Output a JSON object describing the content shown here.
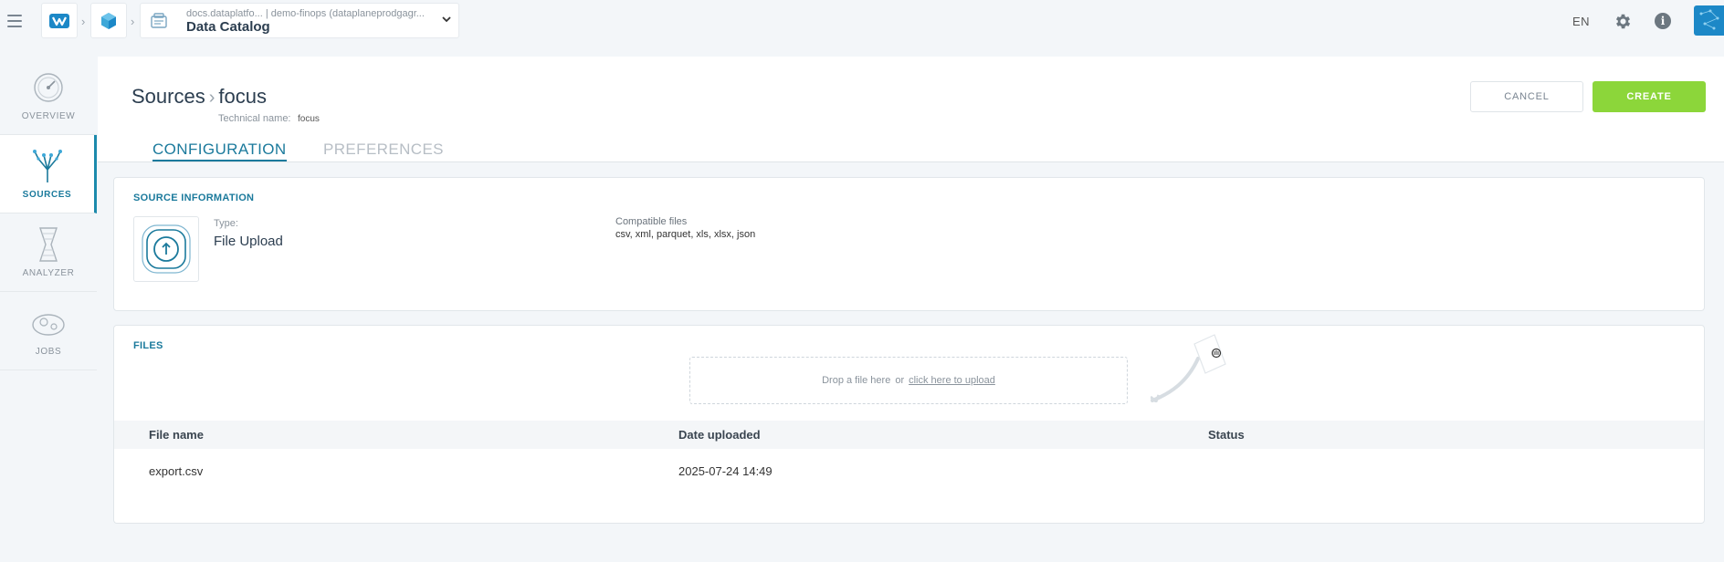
{
  "topbar": {
    "context_app": "docs.dataplatfo... | demo-finops (dataplaneprodgagr...",
    "context_title": "Data Catalog",
    "language": "EN"
  },
  "sidebar": {
    "items": [
      {
        "label": "OVERVIEW",
        "icon": "gauge-icon",
        "active": false
      },
      {
        "label": "SOURCES",
        "icon": "sources-tree-icon",
        "active": true
      },
      {
        "label": "ANALYZER",
        "icon": "analyzer-icon",
        "active": false
      },
      {
        "label": "JOBS",
        "icon": "jobs-icon",
        "active": false
      }
    ]
  },
  "header": {
    "breadcrumb_parent": "Sources",
    "breadcrumb_current": "focus",
    "technical_name_label": "Technical name:",
    "technical_name_value": "focus",
    "tabs": [
      {
        "label": "CONFIGURATION",
        "active": true
      },
      {
        "label": "PREFERENCES",
        "active": false
      }
    ],
    "cancel_label": "CANCEL",
    "create_label": "CREATE"
  },
  "source_info": {
    "title": "SOURCE INFORMATION",
    "type_label": "Type:",
    "type_value": "File Upload",
    "compatible_label": "Compatible files",
    "compatible_value": "csv, xml, parquet, xls, xlsx, json"
  },
  "files": {
    "title": "FILES",
    "drop_text": "Drop a file here",
    "or_text": "or",
    "upload_link": "click here to upload",
    "columns": [
      "File name",
      "Date uploaded",
      "Status"
    ],
    "rows": [
      {
        "file_name": "export.csv",
        "date_uploaded": "2025-07-24 14:49",
        "status": ""
      }
    ]
  },
  "colors": {
    "accent": "#1b7a9c",
    "create_green": "#8cd63a",
    "brand_blue": "#1c88c7"
  }
}
